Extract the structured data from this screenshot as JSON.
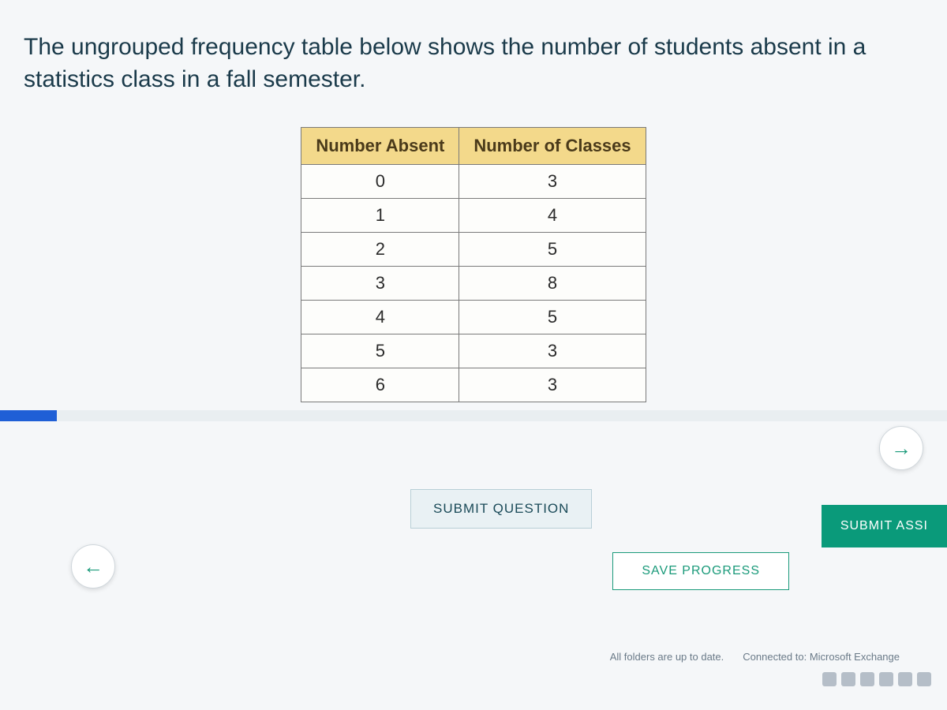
{
  "prompt": "The ungrouped frequency table below shows the number of students absent in a statistics class in a fall semester.",
  "table": {
    "headers": [
      "Number Absent",
      "Number of Classes"
    ],
    "rows": [
      {
        "absent": "0",
        "classes": "3"
      },
      {
        "absent": "1",
        "classes": "4"
      },
      {
        "absent": "2",
        "classes": "5"
      },
      {
        "absent": "3",
        "classes": "8"
      },
      {
        "absent": "4",
        "classes": "5"
      },
      {
        "absent": "5",
        "classes": "3"
      },
      {
        "absent": "6",
        "classes": "3"
      }
    ]
  },
  "buttons": {
    "submit_question": "SUBMIT QUESTION",
    "save_progress": "SAVE PROGRESS",
    "submit_assignment": "SUBMIT ASSI"
  },
  "nav": {
    "left_glyph": "←",
    "right_glyph": "→"
  },
  "status": {
    "folders": "All folders are up to date.",
    "connected": "Connected to: Microsoft Exchange"
  },
  "chart_data": {
    "type": "table",
    "title": "Ungrouped frequency table — number of students absent in a statistics class (fall semester)",
    "columns": [
      "Number Absent",
      "Number of Classes"
    ],
    "data": [
      [
        0,
        3
      ],
      [
        1,
        4
      ],
      [
        2,
        5
      ],
      [
        3,
        8
      ],
      [
        4,
        5
      ],
      [
        5,
        3
      ],
      [
        6,
        3
      ]
    ]
  }
}
